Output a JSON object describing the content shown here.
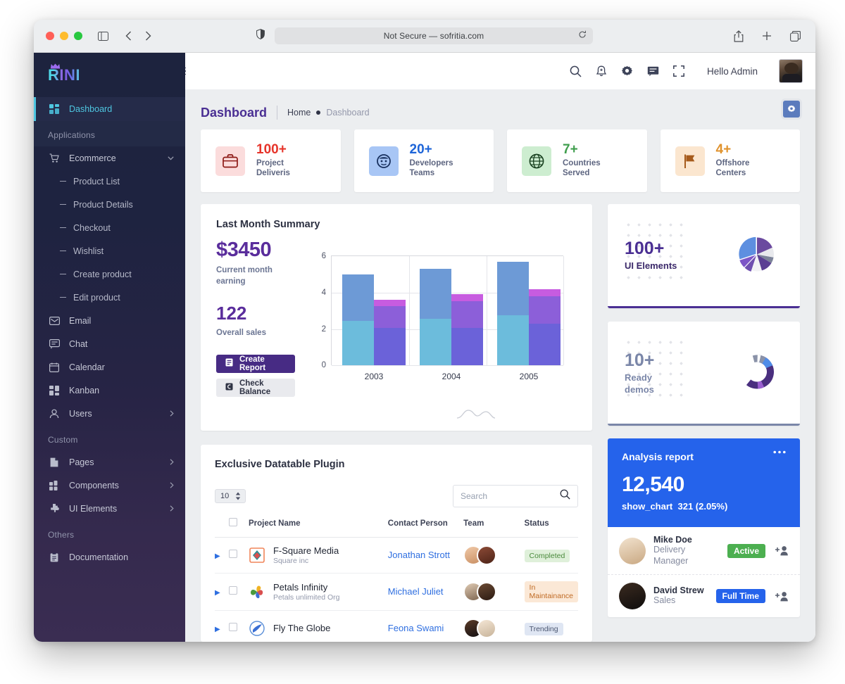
{
  "browser": {
    "url_text": "Not Secure — sofritia.com",
    "icons": {
      "sidebar": "sidebar-icon",
      "back": "chevron-left-icon",
      "forward": "chevron-right-icon",
      "shield": "shield-icon",
      "reload": "reload-icon",
      "share": "share-icon",
      "new_tab": "plus-icon",
      "tabs": "tabs-icon"
    }
  },
  "sidebar": {
    "brand": "RINI",
    "dashboard": {
      "label": "Dashboard",
      "icon": "grid-icon"
    },
    "sections": [
      {
        "title": "Applications",
        "items": [
          {
            "label": "Ecommerce",
            "icon": "cart-icon",
            "caret": "chevron-down-icon",
            "type": "parent"
          },
          {
            "label": "Product List",
            "type": "sub"
          },
          {
            "label": "Product Details",
            "type": "sub"
          },
          {
            "label": "Checkout",
            "type": "sub"
          },
          {
            "label": "Wishlist",
            "type": "sub"
          },
          {
            "label": "Create product",
            "type": "sub"
          },
          {
            "label": "Edit product",
            "type": "sub"
          },
          {
            "label": "Email",
            "icon": "envelope-icon",
            "type": "item"
          },
          {
            "label": "Chat",
            "icon": "chat-icon",
            "type": "item"
          },
          {
            "label": "Calendar",
            "icon": "calendar-icon",
            "type": "item"
          },
          {
            "label": "Kanban",
            "icon": "kanban-icon",
            "type": "item"
          },
          {
            "label": "Users",
            "icon": "user-icon",
            "caret": "chevron-right-icon",
            "type": "item"
          }
        ]
      },
      {
        "title": "Custom",
        "items": [
          {
            "label": "Pages",
            "icon": "page-icon",
            "caret": "chevron-right-icon",
            "type": "item"
          },
          {
            "label": "Components",
            "icon": "components-icon",
            "caret": "chevron-right-icon",
            "type": "item"
          },
          {
            "label": "UI Elements",
            "icon": "puzzle-icon",
            "caret": "chevron-right-icon",
            "type": "item"
          }
        ]
      },
      {
        "title": "Others",
        "items": [
          {
            "label": "Documentation",
            "icon": "clipboard-icon",
            "type": "item"
          }
        ]
      }
    ]
  },
  "topbar": {
    "greeting": "Hello Admin",
    "icons": [
      "search-icon",
      "bell-icon",
      "gear-icon",
      "chat-icon",
      "fullscreen-icon"
    ],
    "hamburger": "hamburger-icon",
    "avatar": "user-avatar"
  },
  "breadcrumb": {
    "title": "Dashboard",
    "home": "Home",
    "current": "Dashboard"
  },
  "stat_cards": [
    {
      "value": "100+",
      "label": "Project\nDeliveris",
      "label_l1": "Project",
      "label_l2": "Deliveris",
      "icon": "briefcase-icon",
      "value_color": "#e6342a",
      "icon_bg": "#fbdcdc",
      "icon_color": "#8e1a16"
    },
    {
      "value": "20+",
      "label_l1": "Developers",
      "label_l2": "Teams",
      "icon": "face-icon",
      "value_color": "#1d64d8",
      "icon_bg": "#a8c6f5",
      "icon_color": "#18305e"
    },
    {
      "value": "7+",
      "label_l1": "Countries",
      "label_l2": "Served",
      "icon": "globe-icon",
      "value_color": "#3f9e4d",
      "icon_bg": "#cdedd0",
      "icon_color": "#18401f"
    },
    {
      "value": "4+",
      "label_l1": "Offshore",
      "label_l2": "Centers",
      "icon": "flag-icon",
      "value_color": "#e0922c",
      "icon_bg": "#fbe6cf",
      "icon_color": "#a65b1c"
    }
  ],
  "summary": {
    "title": "Last Month Summary",
    "earning_value": "$3450",
    "earning_label_l1": "Current month",
    "earning_label_l2": "earning",
    "sales_value": "122",
    "sales_label": "Overall sales",
    "create_report": "Create Report",
    "check_balance": "Check Balance",
    "create_report_icon": "report-icon",
    "check_balance_icon": "balance-icon"
  },
  "chart_data": {
    "type": "bar",
    "title": "Last Month Summary",
    "xlabel": "",
    "ylabel": "",
    "categories": [
      "2003",
      "2004",
      "2005"
    ],
    "ylim": [
      0,
      6
    ],
    "yticks": [
      0,
      2,
      4,
      6
    ],
    "grid": true,
    "stacked": true,
    "legend": null,
    "groups": [
      {
        "category": "2003",
        "bars": [
          {
            "name": "blue",
            "total": 5.0,
            "segments": [
              {
                "color": "#6d9ad6",
                "value": 2.55
              },
              {
                "color": "#6cbcdc",
                "value": 2.45
              }
            ]
          },
          {
            "name": "purple",
            "total": 3.6,
            "segments": [
              {
                "color": "#c75ce0",
                "value": 0.35
              },
              {
                "color": "#8c5fd9",
                "value": 1.2
              },
              {
                "color": "#6b62d9",
                "value": 2.05
              }
            ]
          }
        ]
      },
      {
        "category": "2004",
        "bars": [
          {
            "name": "blue",
            "total": 5.3,
            "segments": [
              {
                "color": "#6d9ad6",
                "value": 2.75
              },
              {
                "color": "#6cbcdc",
                "value": 2.55
              }
            ]
          },
          {
            "name": "purple",
            "total": 3.9,
            "segments": [
              {
                "color": "#c75ce0",
                "value": 0.4
              },
              {
                "color": "#8c5fd9",
                "value": 1.45
              },
              {
                "color": "#6b62d9",
                "value": 2.05
              }
            ]
          }
        ]
      },
      {
        "category": "2005",
        "bars": [
          {
            "name": "blue",
            "total": 5.7,
            "segments": [
              {
                "color": "#6d9ad6",
                "value": 2.95
              },
              {
                "color": "#6cbcdc",
                "value": 2.75
              }
            ]
          },
          {
            "name": "purple",
            "total": 4.2,
            "segments": [
              {
                "color": "#c75ce0",
                "value": 0.4
              },
              {
                "color": "#8c5fd9",
                "value": 1.5
              },
              {
                "color": "#6b62d9",
                "value": 2.3
              }
            ]
          }
        ]
      }
    ]
  },
  "promo_cards": [
    {
      "value": "100+",
      "label_l1": "UI Elements",
      "label_l2": "",
      "value_color": "#4a2f93",
      "label_color": "#3c2a6b",
      "underline": "#4a2f93",
      "chart": {
        "type": "pie",
        "slices": [
          {
            "color": "#5d8fe0",
            "value": 26
          },
          {
            "color": "#7d55c7",
            "value": 9
          },
          {
            "color": "#6f4fb0",
            "value": 6
          },
          {
            "color": "#f0f0f3",
            "value": 9
          },
          {
            "color": "#5b3f93",
            "value": 16
          },
          {
            "color": "#7c8399",
            "value": 11
          },
          {
            "color": "#e8e9ed",
            "value": 7
          },
          {
            "color": "#6b4a9f",
            "value": 16
          }
        ]
      }
    },
    {
      "value": "10+",
      "label_l1": "Ready",
      "label_l2": "demos",
      "value_color": "#7a86a8",
      "label_color": "#7a86a8",
      "underline": "#7a86a8",
      "chart": {
        "type": "donut",
        "slices": [
          {
            "color": "#4a2f7f",
            "value": 58
          },
          {
            "color": "#9a5fd0",
            "value": 6
          },
          {
            "color": "#4f8ce8",
            "value": 20
          },
          {
            "color": "#ffffff",
            "value": 3
          },
          {
            "color": "#8a92a8",
            "value": 13
          }
        ]
      }
    }
  ],
  "analysis": {
    "title": "Analysis report",
    "menu_icon": "more-icon",
    "value": "12,540",
    "sub_label": "show_chart",
    "sub_value": "321 (2.05%)",
    "accent": "#2563eb",
    "people": [
      {
        "name": "Mike Doe",
        "role_l1": "Delivery",
        "role_l2": "Manager",
        "badge": "Active",
        "badge_color": "#4caf50",
        "add_icon": "add-user-icon"
      },
      {
        "name": "David Strew",
        "role_l1": "Sales",
        "role_l2": "",
        "badge": "Full Time",
        "badge_color": "#2563eb",
        "add_icon": "add-user-icon"
      }
    ]
  },
  "datatable": {
    "title": "Exclusive Datatable Plugin",
    "length_value": "10",
    "search_placeholder": "Search",
    "search_value": "",
    "search_icon": "search-icon",
    "columns": [
      "",
      "",
      "Project Name",
      "Contact Person",
      "Team",
      "Status"
    ],
    "headers": {
      "project": "Project Name",
      "contact": "Contact Person",
      "team": "Team",
      "status": "Status"
    },
    "rows": [
      {
        "project": "F-Square Media",
        "sub": "Square inc",
        "contact": "Jonathan Strott",
        "status": "Completed",
        "status_bg": "#dff0da",
        "status_color": "#4a8a3c"
      },
      {
        "project": "Petals Infinity",
        "sub": "Petals unlimited Org",
        "contact": "Michael Juliet",
        "status": "In Maintainance",
        "status_bg": "#fbe8d6",
        "status_color": "#c06b25"
      },
      {
        "project": "Fly The Globe",
        "sub": "",
        "contact": "Feona Swami",
        "status": "Trending",
        "status_bg": "#dfe6f3",
        "status_color": "#4a5670"
      }
    ]
  }
}
